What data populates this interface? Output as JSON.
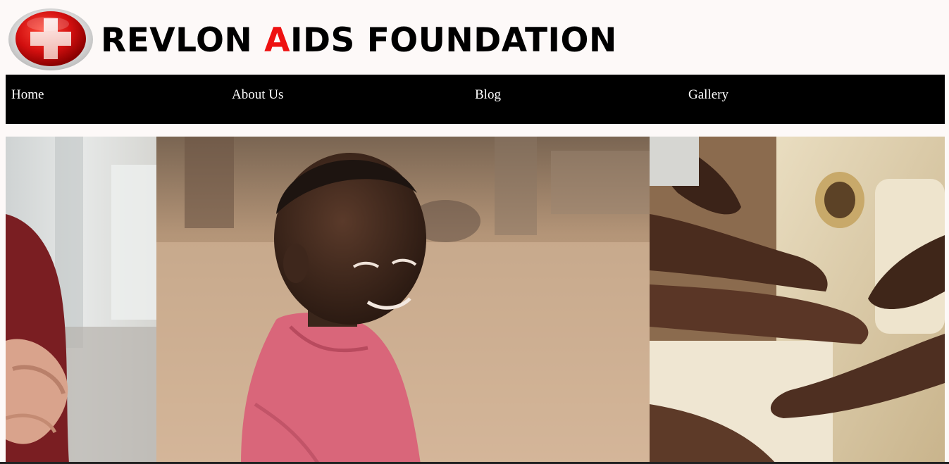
{
  "header": {
    "logo_icon": "red-cross-badge-icon",
    "title_parts": [
      "REVLON ",
      "A",
      "IDS FOUNDATION"
    ]
  },
  "nav": {
    "items": [
      {
        "label": "Home"
      },
      {
        "label": "About Us"
      },
      {
        "label": "Blog"
      },
      {
        "label": "Gallery"
      }
    ]
  },
  "gallery": {
    "photos": [
      {
        "name": "person-in-red-shirt-photo"
      },
      {
        "name": "smiling-child-pink-hoodie-photo"
      },
      {
        "name": "hands-on-water-jugs-photo"
      }
    ]
  },
  "colors": {
    "accent": "#ee1111",
    "nav_background": "#000000",
    "page_background": "#fdf9f8"
  }
}
